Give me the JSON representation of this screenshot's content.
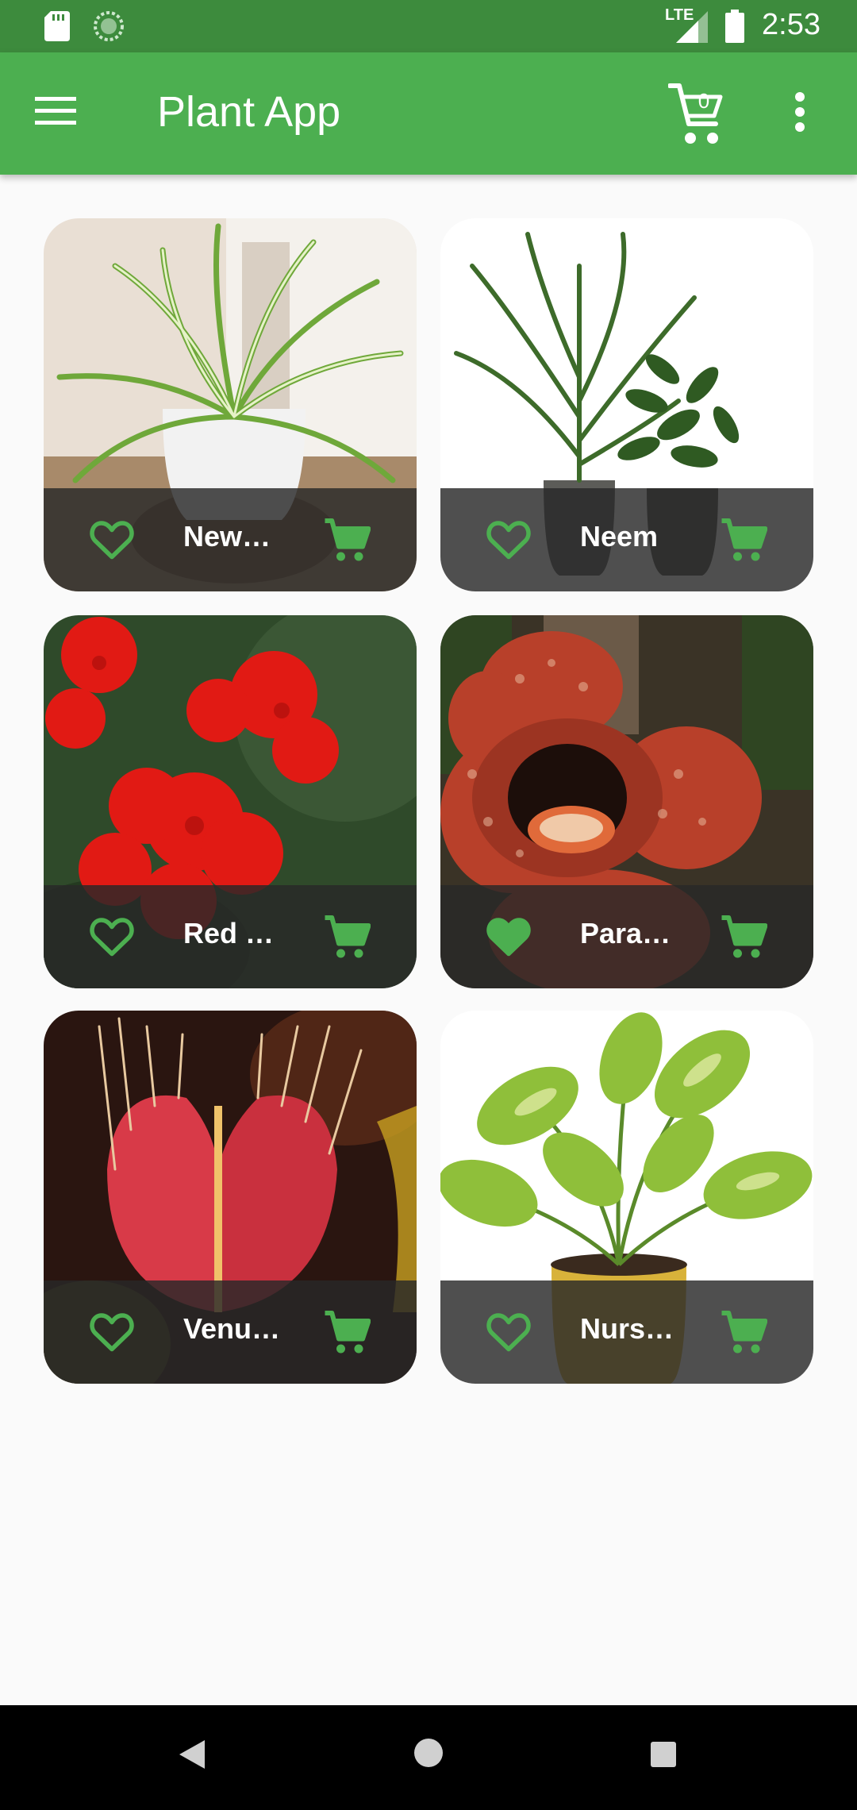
{
  "status_bar": {
    "network": "LTE",
    "time": "2:53"
  },
  "app_bar": {
    "title": "Plant App",
    "cart_count": "0"
  },
  "plants": [
    {
      "name": "New…",
      "favorite": false
    },
    {
      "name": "Neem",
      "favorite": false
    },
    {
      "name": "Red …",
      "favorite": false
    },
    {
      "name": "Para…",
      "favorite": true
    },
    {
      "name": "Venu…",
      "favorite": false
    },
    {
      "name": "Nurs…",
      "favorite": false
    }
  ],
  "colors": {
    "primary": "#4caf50",
    "status_bar": "#3d8b3d",
    "accent": "#4caf50"
  }
}
